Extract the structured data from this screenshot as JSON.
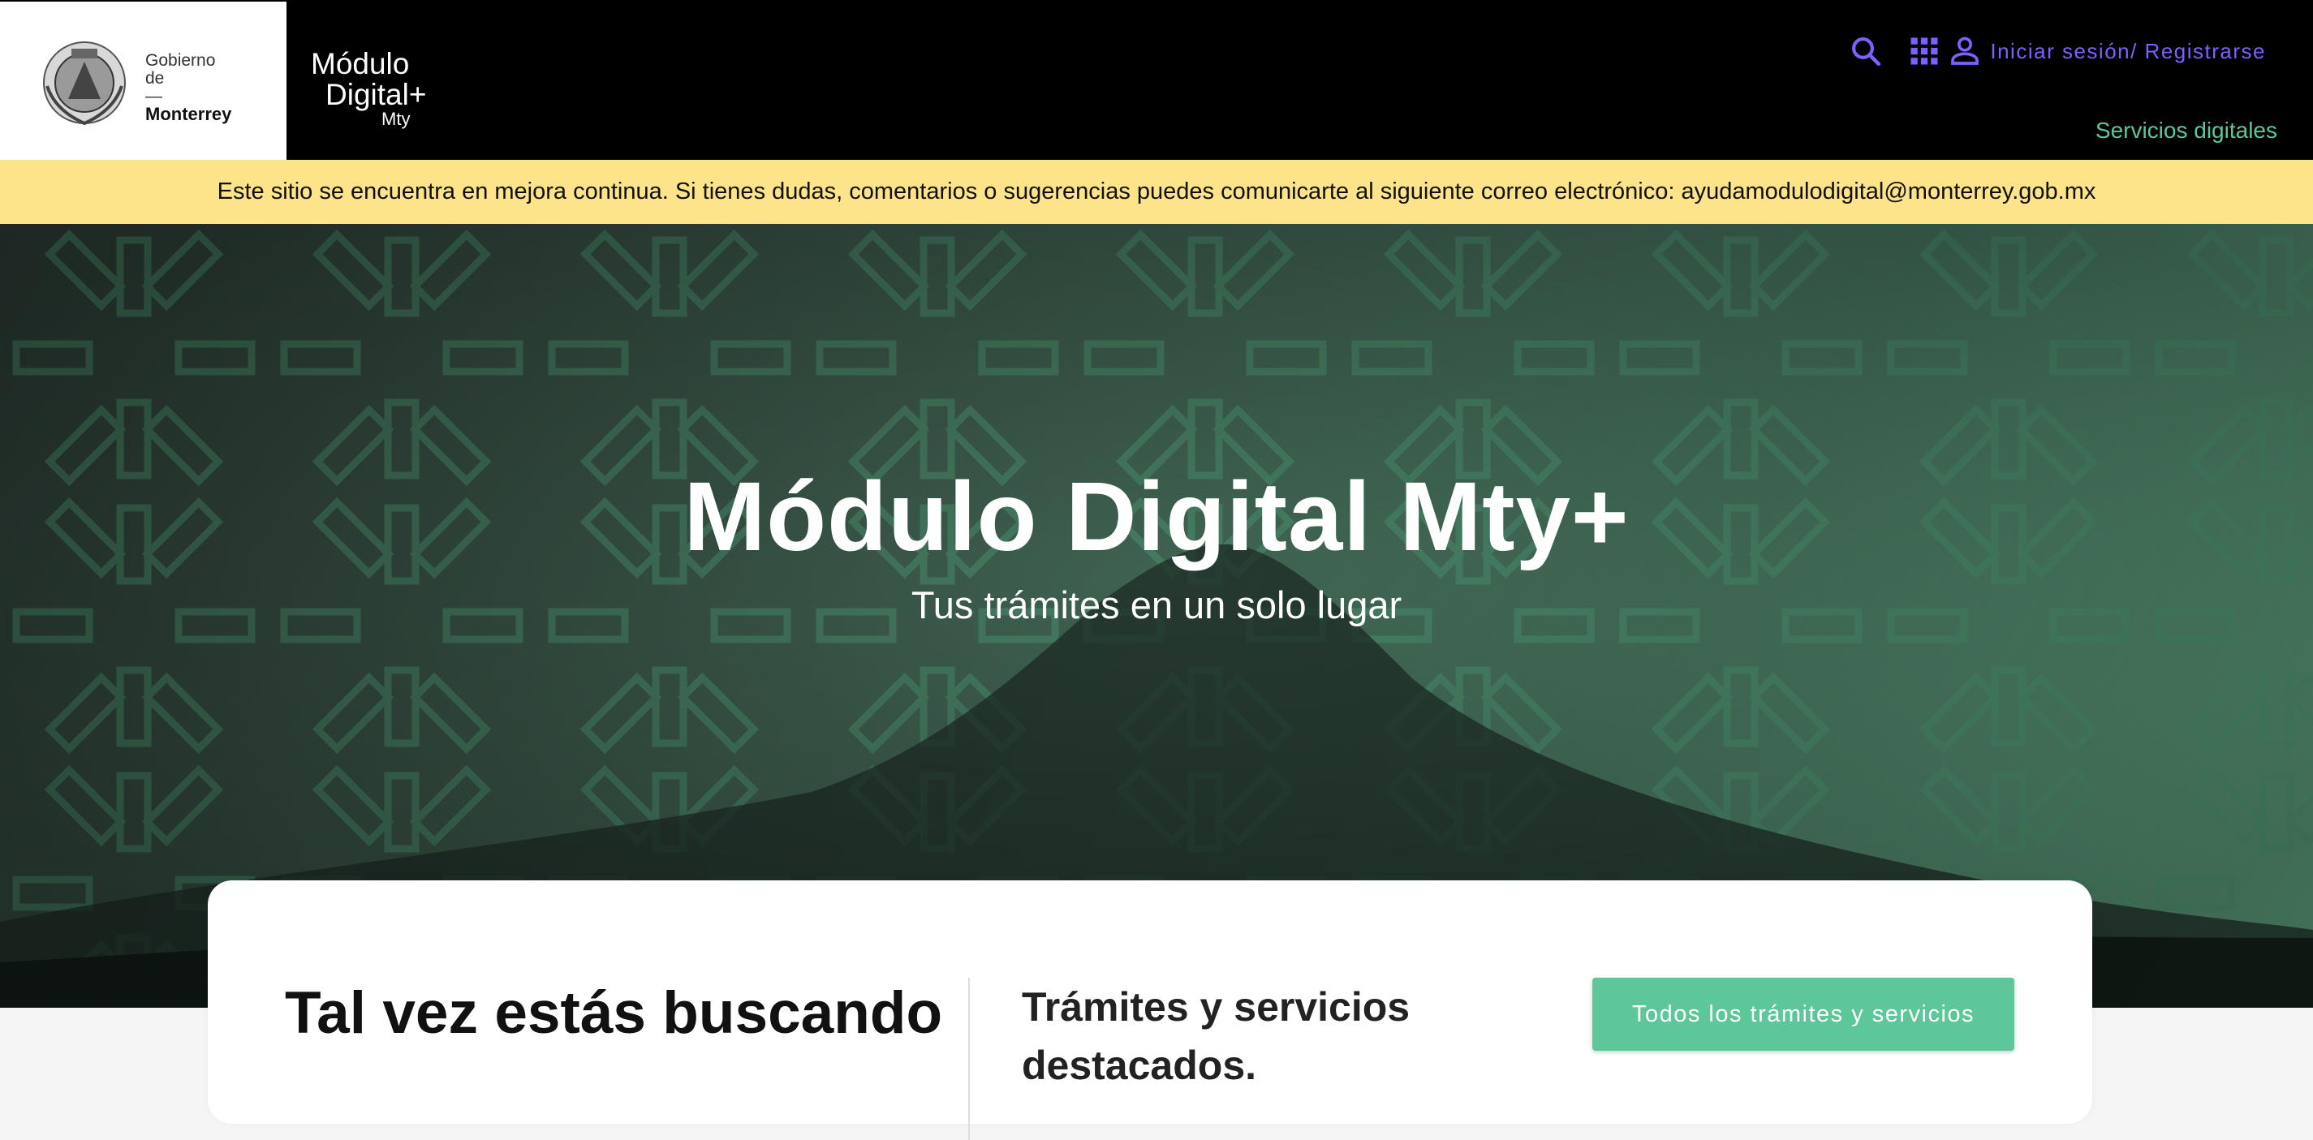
{
  "header": {
    "government": {
      "line1": "Gobierno",
      "line2": "de",
      "line3": "—",
      "line4": "Monterrey"
    },
    "brand": {
      "line1": "Módulo",
      "line2": "Digital+",
      "line3": "Mty"
    },
    "search_icon": "search-icon",
    "apps_icon": "grid-apps-icon",
    "user_icon": "user-icon",
    "login_label": "Iniciar sesión/ Registrarse",
    "services_link": "Servicios digitales"
  },
  "notice": {
    "text": "Este sitio se encuentra en mejora continua. Si tienes dudas, comentarios o sugerencias puedes comunicarte al siguiente correo electrónico: ayudamodulodigital@monterrey.gob.mx"
  },
  "hero": {
    "title": "Módulo Digital Mty+",
    "subtitle": "Tus trámites en un solo lugar"
  },
  "search_section": {
    "title": "Tal vez estás buscando",
    "featured_label": "Trámites y servicios destacados.",
    "all_button": "Todos los trámites y servicios"
  },
  "colors": {
    "accent_green": "#5ec79a",
    "accent_purple": "#7b61ff",
    "notice_bg": "#fde38a",
    "header_bg": "#000000"
  }
}
